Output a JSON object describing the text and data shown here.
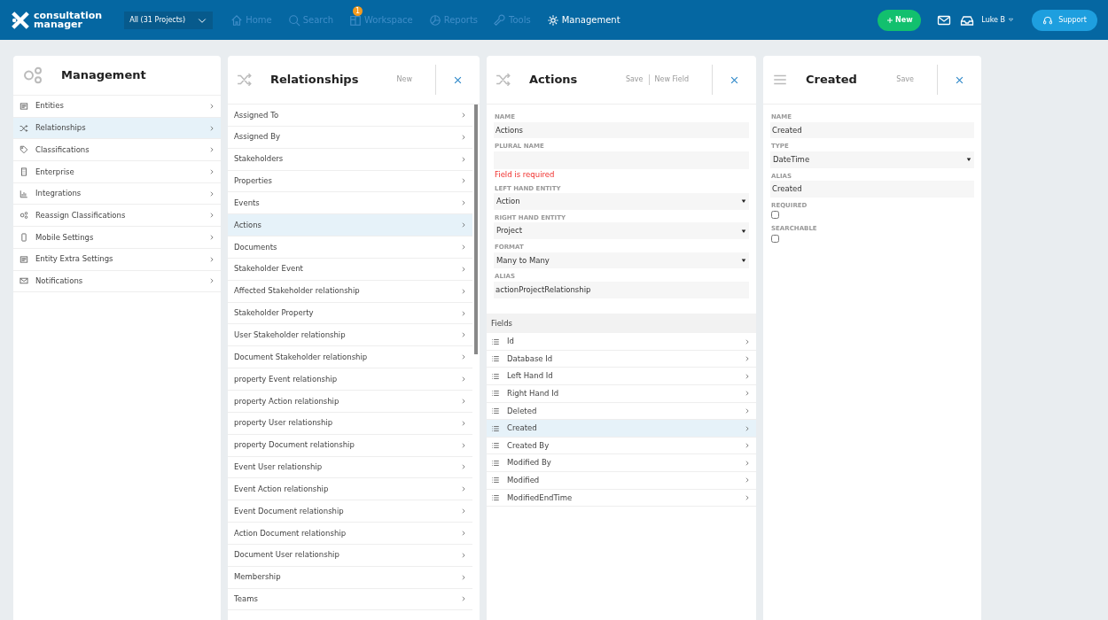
{
  "header": {
    "logo": [
      "consultation",
      "manager"
    ],
    "project_selector": "All (31 Projects)",
    "nav": [
      {
        "label": "Home",
        "selected": false
      },
      {
        "label": "Search",
        "selected": false
      },
      {
        "label": "Workspace",
        "selected": false,
        "badge": "1"
      },
      {
        "label": "Reports",
        "selected": false
      },
      {
        "label": "Tools",
        "selected": false
      },
      {
        "label": "Management",
        "selected": true
      }
    ],
    "new_button": "New",
    "user": "Luke B",
    "support": "Support"
  },
  "management": {
    "title": "Management",
    "items": [
      {
        "label": "Entities",
        "selected": false
      },
      {
        "label": "Relationships",
        "selected": true
      },
      {
        "label": "Classifications",
        "selected": false
      },
      {
        "label": "Enterprise",
        "selected": false
      },
      {
        "label": "Integrations",
        "selected": false
      },
      {
        "label": "Reassign Classifications",
        "selected": false
      },
      {
        "label": "Mobile Settings",
        "selected": false
      },
      {
        "label": "Entity Extra Settings",
        "selected": false
      },
      {
        "label": "Notifications",
        "selected": false
      }
    ]
  },
  "relationships": {
    "title": "Relationships",
    "action": "New",
    "items": [
      {
        "label": "Assigned To",
        "selected": false
      },
      {
        "label": "Assigned By",
        "selected": false
      },
      {
        "label": "Stakeholders",
        "selected": false
      },
      {
        "label": "Properties",
        "selected": false
      },
      {
        "label": "Events",
        "selected": false
      },
      {
        "label": "Actions",
        "selected": true
      },
      {
        "label": "Documents",
        "selected": false
      },
      {
        "label": "Stakeholder Event",
        "selected": false
      },
      {
        "label": "Affected Stakeholder relationship",
        "selected": false
      },
      {
        "label": "Stakeholder Property",
        "selected": false
      },
      {
        "label": "User Stakeholder relationship",
        "selected": false
      },
      {
        "label": "Document Stakeholder relationship",
        "selected": false
      },
      {
        "label": "property Event relationship",
        "selected": false
      },
      {
        "label": "property Action relationship",
        "selected": false
      },
      {
        "label": "property User relationship",
        "selected": false
      },
      {
        "label": "property Document relationship",
        "selected": false
      },
      {
        "label": "Event User relationship",
        "selected": false
      },
      {
        "label": "Event Action relationship",
        "selected": false
      },
      {
        "label": "Event Document relationship",
        "selected": false
      },
      {
        "label": "Action Document relationship",
        "selected": false
      },
      {
        "label": "Document User relationship",
        "selected": false
      },
      {
        "label": "Membership",
        "selected": false
      },
      {
        "label": "Teams",
        "selected": false
      }
    ]
  },
  "actions": {
    "title": "Actions",
    "buttons": [
      "Save",
      "New Field"
    ],
    "form": [
      {
        "kind": "text",
        "label": "NAME",
        "value": "Actions"
      },
      {
        "kind": "text",
        "label": "PLURAL NAME",
        "error": "Field is required"
      },
      {
        "kind": "select",
        "label": "LEFT HAND ENTITY",
        "value": "Action"
      },
      {
        "kind": "select",
        "label": "RIGHT HAND ENTITY",
        "value": "Project"
      },
      {
        "kind": "select",
        "label": "FORMAT",
        "value": "Many to Many"
      },
      {
        "kind": "text",
        "label": "ALIAS",
        "value": "actionProjectRelationship"
      }
    ],
    "fields_title": "Fields",
    "fields": [
      {
        "label": "Id",
        "selected": false
      },
      {
        "label": "Database Id",
        "selected": false
      },
      {
        "label": "Left Hand Id",
        "selected": false
      },
      {
        "label": "Right Hand Id",
        "selected": false
      },
      {
        "label": "Deleted",
        "selected": false
      },
      {
        "label": "Created",
        "selected": true
      },
      {
        "label": "Created By",
        "selected": false
      },
      {
        "label": "Modified By",
        "selected": false
      },
      {
        "label": "Modified",
        "selected": false
      },
      {
        "label": "ModifiedEndTime",
        "selected": false
      }
    ]
  },
  "created": {
    "title": "Created",
    "buttons": [
      "Save"
    ],
    "form": [
      {
        "kind": "text",
        "label": "NAME",
        "value": "Created"
      },
      {
        "kind": "select",
        "label": "TYPE",
        "value": "DateTime"
      },
      {
        "kind": "text",
        "label": "ALIAS",
        "value": "Created"
      },
      {
        "kind": "checkbox",
        "label": "REQUIRED",
        "checked": false
      },
      {
        "kind": "checkbox",
        "label": "SEARCHABLE",
        "checked": false
      }
    ]
  }
}
